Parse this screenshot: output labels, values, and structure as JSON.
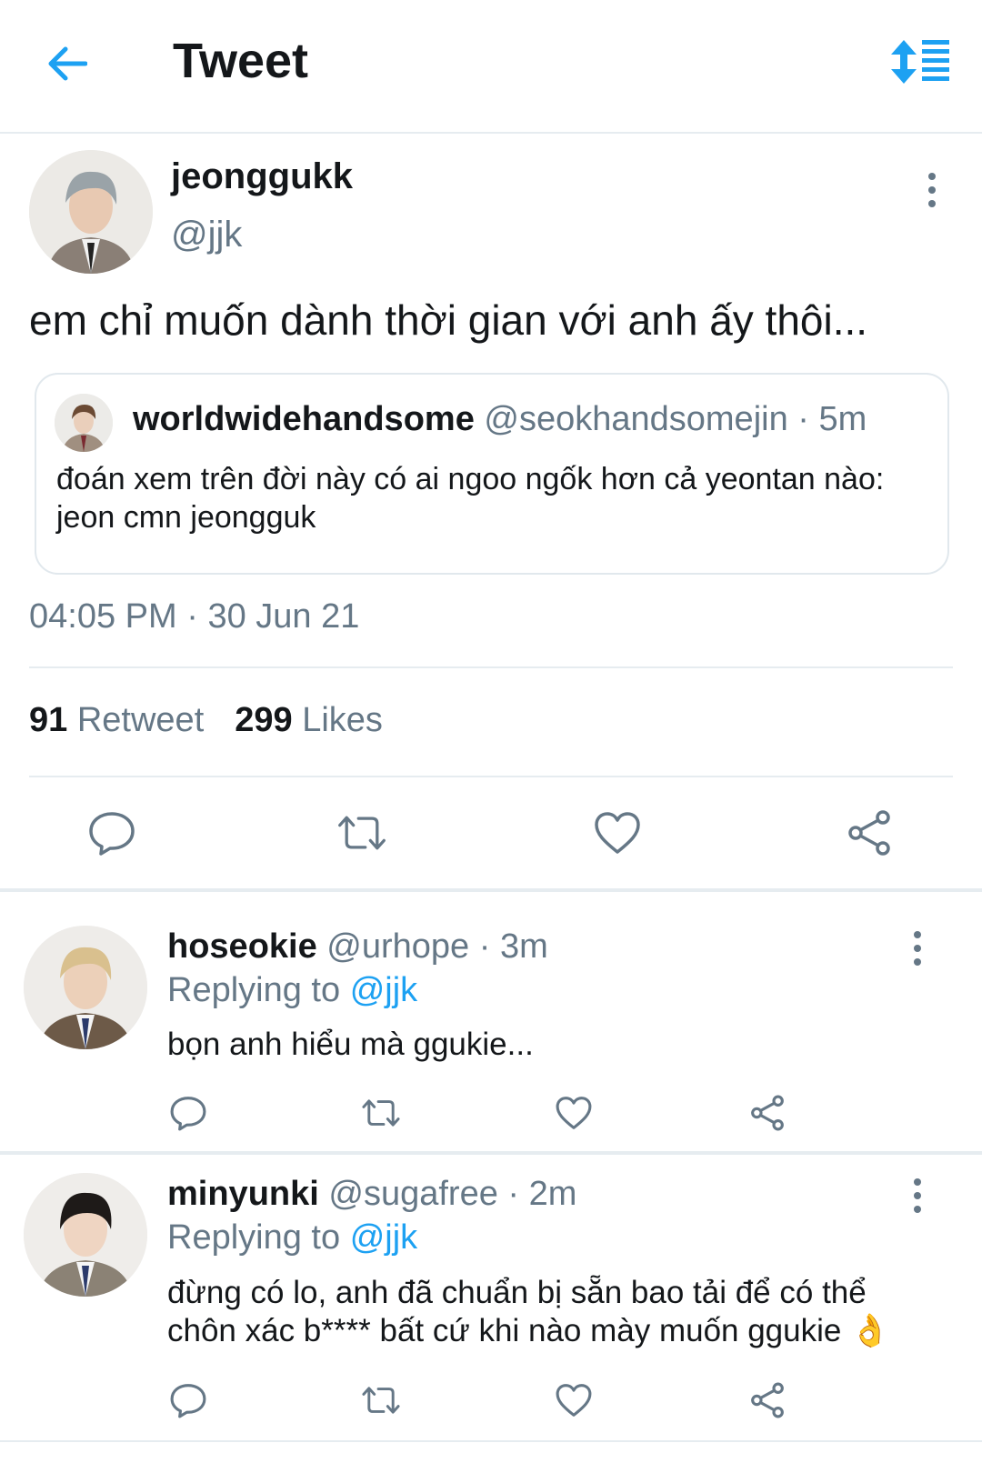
{
  "header": {
    "title": "Tweet",
    "back_icon": "arrow-left-icon",
    "sort_icon": "sort-list-icon",
    "accent": "#1da1f2"
  },
  "tweet": {
    "name": "jeonggukk",
    "handle": "@jjk",
    "text": "em chỉ muốn dành thời gian với anh ấy thôi...",
    "quote": {
      "name": "worldwidehandsome",
      "handle": "@seokhandsomejin",
      "sep": "·",
      "time": "5m",
      "text": "đoán xem trên đời này có ai ngoo ngốk hơn cả yeontan nào: jeon cmn jeongguk"
    },
    "time": "04:05 PM",
    "dot": "·",
    "date": "30 Jun 21",
    "retweets_count": "91",
    "retweets_label": "Retweet",
    "likes_count": "299",
    "likes_label": "Likes"
  },
  "replies": [
    {
      "name": "hoseokie",
      "handle": "@urhope",
      "sep": "·",
      "time": "3m",
      "replying_label": "Replying to",
      "replying_handle": "@jjk",
      "text": "bọn anh hiểu mà ggukie..."
    },
    {
      "name": "minyunki",
      "handle": "@sugafree",
      "sep": "·",
      "time": "2m",
      "replying_label": "Replying to",
      "replying_handle": "@jjk",
      "text": "đừng có lo, anh đã chuẩn bị sẵn bao tải để có thể chôn xác b**** bất cứ khi nào mày muốn ggukie 👌"
    }
  ],
  "colors": {
    "text": "#14171a",
    "secondary": "#657786",
    "accent": "#1da1f2",
    "divider": "#e6ecf0"
  }
}
